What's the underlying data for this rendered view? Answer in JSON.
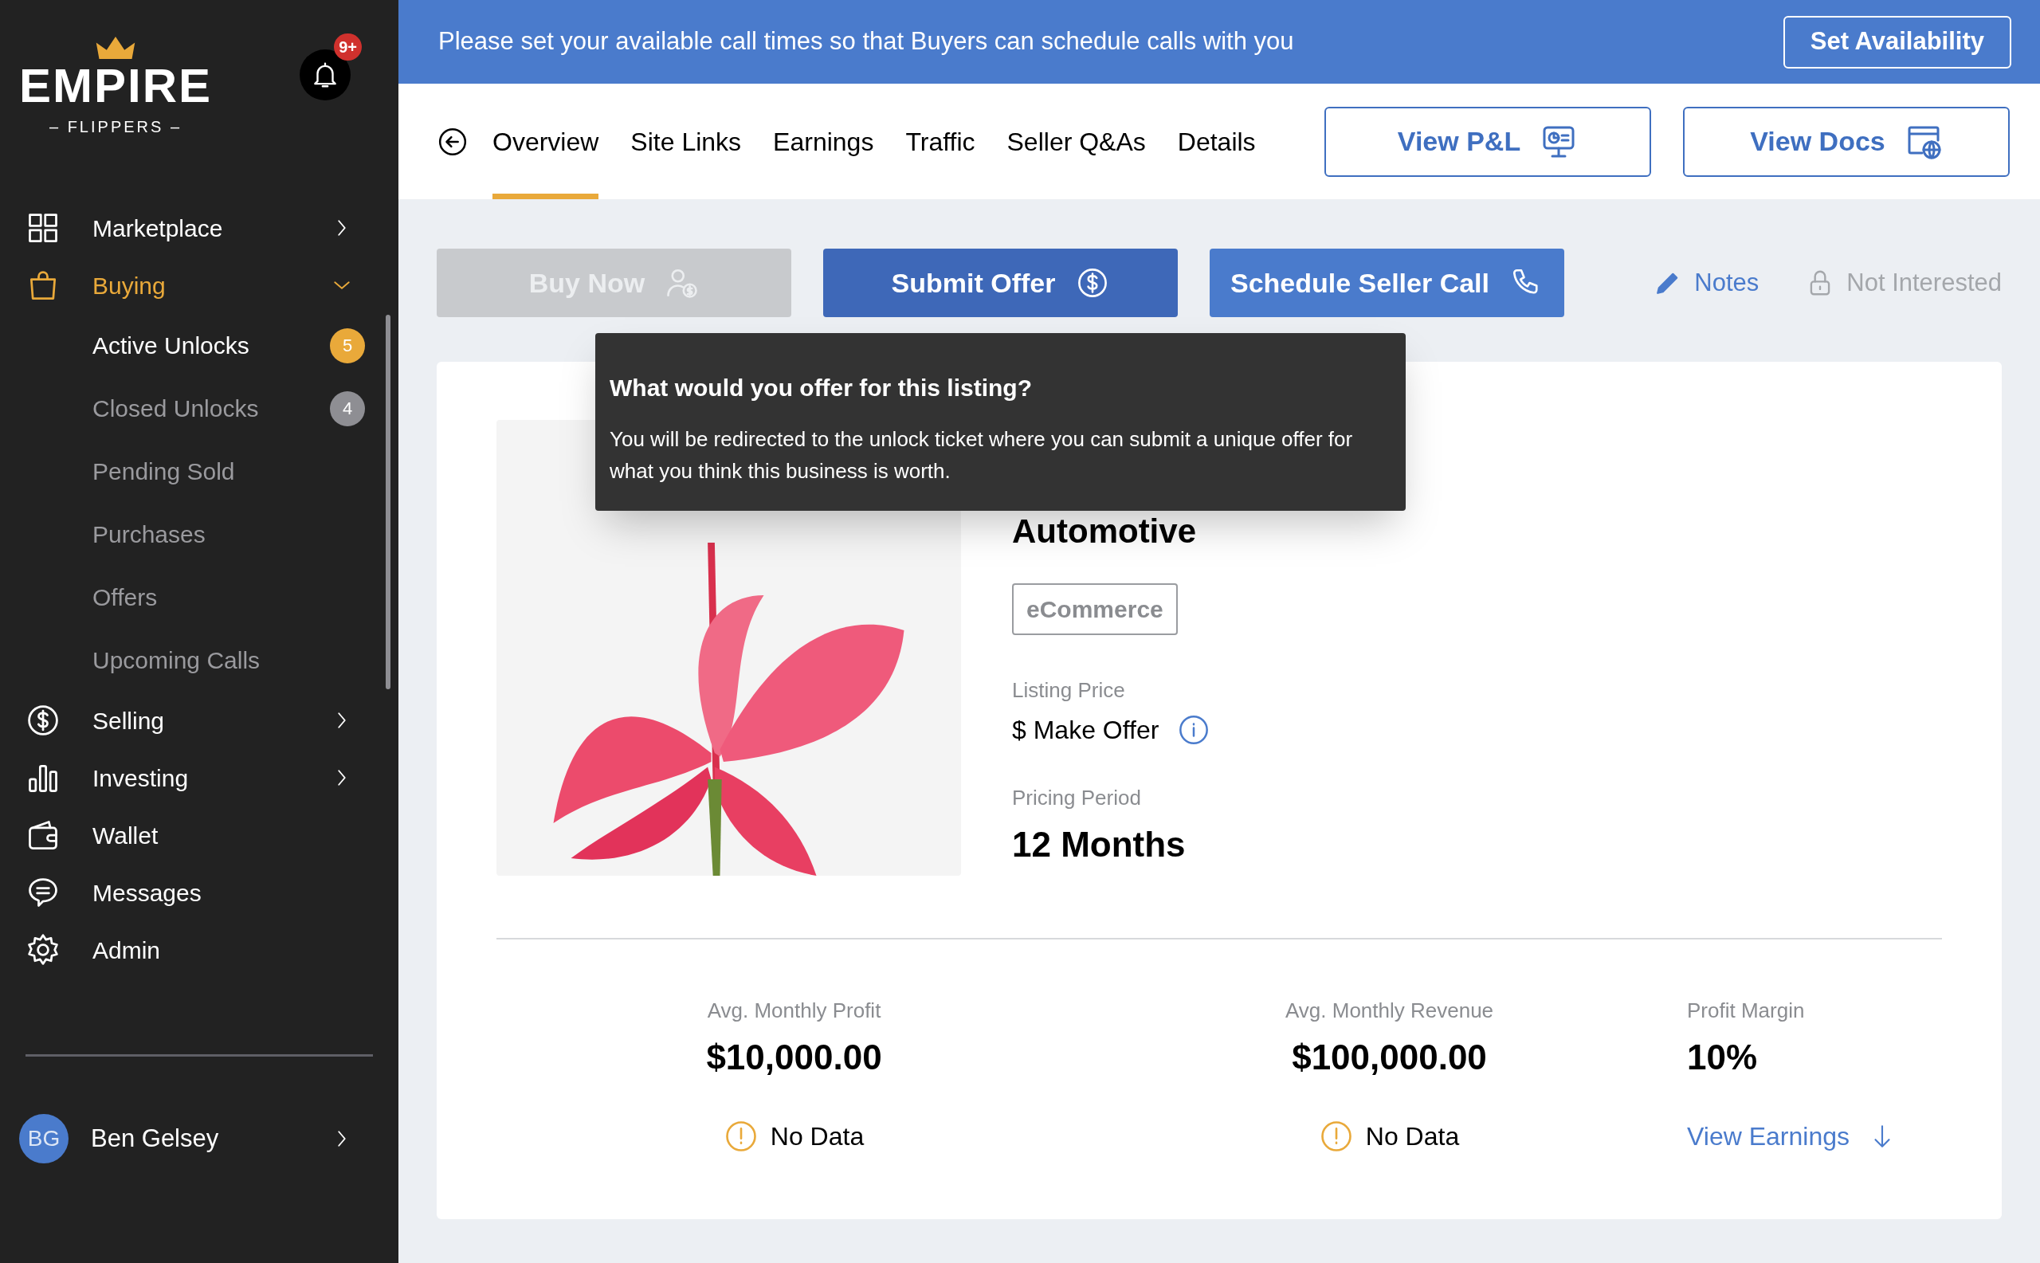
{
  "logo": {
    "title": "EMPIRE",
    "subtitle": "– FLIPPERS –"
  },
  "notifications": {
    "badge": "9+"
  },
  "sidebar": {
    "items": [
      {
        "kind": "group",
        "label": "Marketplace",
        "expanded": false
      },
      {
        "kind": "group",
        "label": "Buying",
        "expanded": true,
        "children": [
          {
            "label": "Active Unlocks",
            "selected": true,
            "badge": "5",
            "color": "#e9a93a"
          },
          {
            "label": "Closed Unlocks",
            "selected": false,
            "badge": "4",
            "color": "#8e8e93"
          },
          {
            "label": "Pending Sold",
            "selected": false
          },
          {
            "label": "Purchases",
            "selected": false
          },
          {
            "label": "Offers",
            "selected": false
          },
          {
            "label": "Upcoming Calls",
            "selected": false
          }
        ]
      },
      {
        "kind": "group",
        "label": "Selling",
        "expanded": false
      },
      {
        "kind": "group",
        "label": "Investing",
        "expanded": false
      },
      {
        "kind": "link",
        "label": "Wallet"
      },
      {
        "kind": "link",
        "label": "Messages"
      },
      {
        "kind": "link",
        "label": "Admin"
      }
    ]
  },
  "user": {
    "initials": "BG",
    "name": "Ben Gelsey"
  },
  "banner": {
    "text": "Please set your available call times so that Buyers can schedule calls with you",
    "button": "Set Availability"
  },
  "tabs": [
    {
      "label": "Overview",
      "selected": true
    },
    {
      "label": "Site Links",
      "selected": false
    },
    {
      "label": "Earnings",
      "selected": false
    },
    {
      "label": "Traffic",
      "selected": false
    },
    {
      "label": "Seller Q&As",
      "selected": false
    },
    {
      "label": "Details",
      "selected": false
    }
  ],
  "header_buttons": [
    {
      "label": "View P&L"
    },
    {
      "label": "View Docs"
    }
  ],
  "actions": [
    {
      "label": "Buy Now",
      "disabled": true
    },
    {
      "label": "Submit Offer",
      "disabled": false
    },
    {
      "label": "Schedule Seller Call",
      "disabled": false
    }
  ],
  "links": [
    {
      "label": "Notes",
      "disabled": false
    },
    {
      "label": "Not Interested",
      "disabled": true
    }
  ],
  "tooltip": {
    "title": "What would you offer for this listing?",
    "text": "You will be redirected to the unlock ticket where you can submit a unique offer for what you think this business is worth."
  },
  "listing": {
    "title": "Automotive",
    "tag": "eCommerce",
    "fields": [
      {
        "label": "Listing Price",
        "value": "$ Make Offer"
      },
      {
        "label": "Pricing Period",
        "value": "12 Months"
      }
    ]
  },
  "stats": [
    {
      "label": "Avg. Monthly Profit",
      "value": "$10,000.00",
      "footer": {
        "kind": "warning",
        "text": "No Data"
      }
    },
    {
      "label": "Avg. Monthly Revenue",
      "value": "$100,000.00",
      "footer": {
        "kind": "warning",
        "text": "No Data"
      }
    },
    {
      "label": "Profit Margin",
      "value": "10%",
      "footer": {
        "kind": "link",
        "text": "View Earnings"
      }
    }
  ]
}
